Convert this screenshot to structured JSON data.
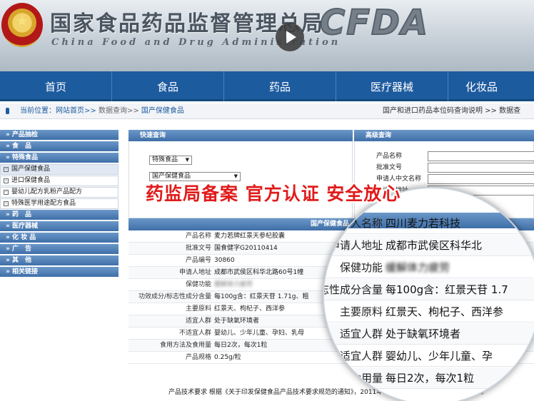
{
  "header": {
    "title_cn": "国家食品药品监督管理总局",
    "title_en": "China Food and Drug Administration",
    "logo_text": "CFDA"
  },
  "icons": {
    "emblem": "national-emblem-icon",
    "play": "play-icon",
    "location": "location-pin-icon",
    "tree_box": "expand-box-icon",
    "dropdown": "chevron-down-icon"
  },
  "colors": {
    "nav_blue": "#1d5b9f",
    "promo_red": "#e11b1b",
    "panel_blue": "#3f6fa8"
  },
  "nav": {
    "items": [
      "首页",
      "食品",
      "药品",
      "医疗器械",
      "化妆品"
    ]
  },
  "breadcrumb": {
    "label": "当前位置：",
    "home": "网站首页>>",
    "level2": "数据查询>>",
    "level3": "国产保健食品",
    "right_link": "国产和进口药品本位码查询说明 >>",
    "right_link2": "数据查"
  },
  "sidebar": {
    "items": [
      {
        "type": "cat",
        "label": "» 产品抽检"
      },
      {
        "type": "cat",
        "label": "» 食　品"
      },
      {
        "type": "cat",
        "label": "» 特殊食品"
      },
      {
        "type": "sub",
        "label": "国产保健食品",
        "active": true
      },
      {
        "type": "sub",
        "label": "进口保健食品"
      },
      {
        "type": "sub",
        "label": "婴幼儿配方乳粉产品配方"
      },
      {
        "type": "sub",
        "label": "特殊医学用途配方食品"
      },
      {
        "type": "cat",
        "label": "» 药　品"
      },
      {
        "type": "cat",
        "label": "» 医疗器械"
      },
      {
        "type": "cat",
        "label": "» 化 妆 品"
      },
      {
        "type": "cat",
        "label": "» 广　告"
      },
      {
        "type": "cat",
        "label": "» 其　他"
      },
      {
        "type": "cat",
        "label": "» 相关链接"
      }
    ]
  },
  "quick_query": {
    "title": "快速查询",
    "select1": "特殊食品",
    "select2": "国产保健食品"
  },
  "advanced_query": {
    "title": "高级查询",
    "fields": [
      "产品名称",
      "批准文号",
      "申请人中文名称",
      "申请人地址"
    ]
  },
  "promo": {
    "text": "药监局备案 官方认证 安全放心"
  },
  "result": {
    "title": "国产保健食品",
    "rows": [
      {
        "label": "产品名称",
        "value": "麦力若牌红景天参杞胶囊",
        "blur": false
      },
      {
        "label": "批准文号",
        "value": "国食健字G20110414",
        "blur": false
      },
      {
        "label": "产品编号",
        "value": "30860",
        "blur": false
      },
      {
        "label": "申请人地址",
        "value": "成都市武侯区科华北路60号1幢",
        "blur": false
      },
      {
        "label": "保健功能",
        "value": "缓解体力疲劳",
        "blur": true
      },
      {
        "label": "功效成分/标志性成分含量",
        "value": "每100g含：红景天苷 1.71g、粗",
        "blur": false
      },
      {
        "label": "主要原料",
        "value": "红景天、枸杞子、西洋参",
        "blur": false
      },
      {
        "label": "适宜人群",
        "value": "处于缺氧环境者",
        "blur": false
      },
      {
        "label": "不适宜人群",
        "value": "婴幼儿、少年儿童、孕妇、乳母",
        "blur": false
      },
      {
        "label": "食用方法及食用量",
        "value": "每日2次，每次1粒",
        "blur": false
      },
      {
        "label": "产品规格",
        "value": "0.25g/粒",
        "blur": false
      }
    ],
    "footer": "产品技术要求 根据《关于印发保健食品产品技术要求规范的通知》，2011年2月1日前受理的产品暂无技术要求。"
  },
  "magnifier": {
    "rows": [
      {
        "label": "申请人名称",
        "value": "四川麦力若科技",
        "blur": false
      },
      {
        "label": "申请人地址",
        "value": "成都市武侯区科华北",
        "blur": false
      },
      {
        "label": "保健功能",
        "value": "缓解体力疲劳",
        "blur": true
      },
      {
        "label": "标志性成分含量",
        "value": "每100g含：红景天苷 1.7",
        "blur": false
      },
      {
        "label": "主要原料",
        "value": "红景天、枸杞子、西洋参",
        "blur": false
      },
      {
        "label": "适宜人群",
        "value": "处于缺氧环境者",
        "blur": false
      },
      {
        "label": "不适宜人群",
        "value": "婴幼儿、少年儿童、孕",
        "blur": false
      },
      {
        "label": "食用量",
        "value": "每日2次，每次1粒",
        "blur": false
      }
    ]
  }
}
